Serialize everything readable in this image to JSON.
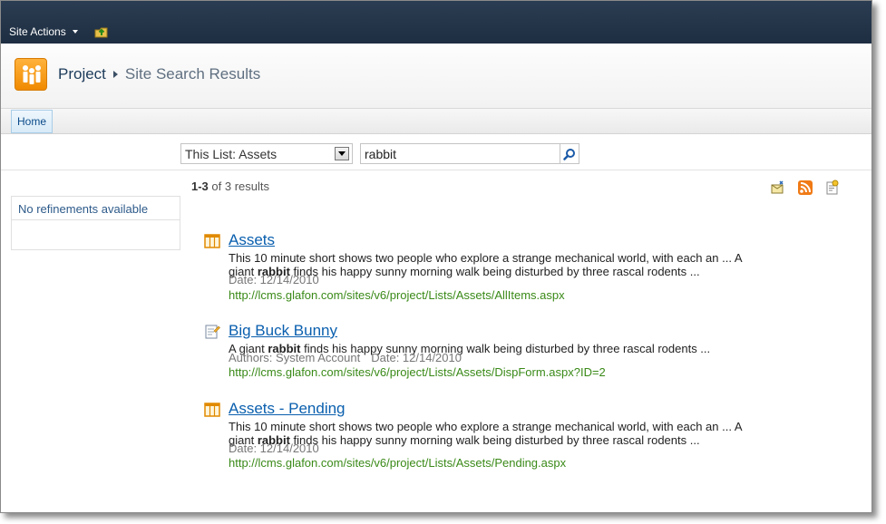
{
  "topbar": {
    "site_actions_label": "Site Actions"
  },
  "breadcrumb": {
    "root": "Project",
    "page": "Site Search Results"
  },
  "topnav": {
    "home_label": "Home"
  },
  "search": {
    "scope_value": "This List: Assets",
    "query": "rabbit"
  },
  "refinement": {
    "text": "No refinements available"
  },
  "results_header": {
    "range": "1-3",
    "of_text": " of 3 results"
  },
  "results": [
    {
      "title": "Assets",
      "icon": "list-icon",
      "line1": "This 10 minute short shows two people who explore a strange mechanical world, with each an ... A",
      "pre": "giant ",
      "highlight": "rabbit",
      "post": " finds his happy sunny morning walk being disturbed by three rascal rodents ...",
      "meta": "Date: 12/14/2010",
      "url": "http://lcms.glafon.com/sites/v6/project/Lists/Assets/AllItems.aspx"
    },
    {
      "title": "Big Buck Bunny",
      "icon": "list-item-icon",
      "pre": "A giant ",
      "highlight": "rabbit",
      "post": " finds his happy sunny morning walk being disturbed by three rascal rodents ...",
      "authors": "Authors: System Account",
      "meta": "Date: 12/14/2010",
      "url": "http://lcms.glafon.com/sites/v6/project/Lists/Assets/DispForm.aspx?ID=2"
    },
    {
      "title": "Assets - Pending",
      "icon": "list-icon",
      "line1": "This 10 minute short shows two people who explore a strange mechanical world, with each an ... A",
      "pre": "giant ",
      "highlight": "rabbit",
      "post": " finds his happy sunny morning walk being disturbed by three rascal rodents ...",
      "meta": "Date: 12/14/2010",
      "url": "http://lcms.glafon.com/sites/v6/project/Lists/Assets/Pending.aspx"
    }
  ],
  "colors": {
    "topbar": "#1e2e42",
    "link": "#0a5fae",
    "url": "#3a8a18",
    "logo": "#f08a00"
  }
}
